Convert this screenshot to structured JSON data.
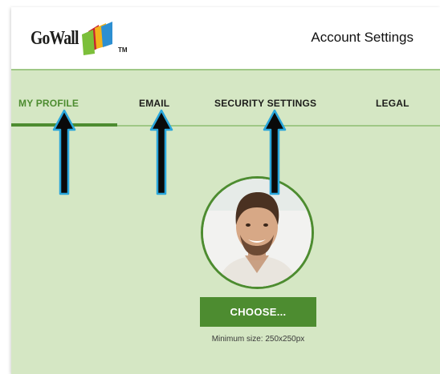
{
  "header": {
    "logo_text": "GoWall",
    "logo_tm": "TM",
    "page_title": "Account Settings"
  },
  "tabs": [
    {
      "label": "MY PROFILE",
      "active": true
    },
    {
      "label": "EMAIL",
      "active": false
    },
    {
      "label": "SECURITY SETTINGS",
      "active": false
    },
    {
      "label": "LEGAL",
      "active": false
    }
  ],
  "profile": {
    "choose_label": "CHOOSE...",
    "min_size_hint": "Minimum size: 250x250px"
  },
  "annotations": {
    "arrow_count": 3,
    "arrow_fill": "#0a0a0a",
    "arrow_outline": "#29a6dc"
  },
  "colors": {
    "accent_green": "#4d8c30",
    "background_green": "#d5e7c4",
    "divider_green": "#9fc886"
  }
}
